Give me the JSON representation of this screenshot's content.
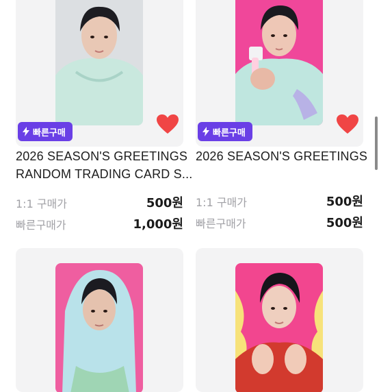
{
  "products": [
    {
      "badge": "빠른구매",
      "title_line1": "2026 SEASON'S GREETINGS",
      "title_line2": "RANDOM TRADING CARD S...",
      "price_1to1_label": "1:1 구매가",
      "price_1to1": "500원",
      "price_quick_label": "빠른구매가",
      "price_quick": "1,000원",
      "favorited": true,
      "photo_colors": {
        "bg": "#d9dde0",
        "hoodie": "#c9e8de",
        "skin": "#e9c8b5",
        "hair": "#1d1d22"
      }
    },
    {
      "badge": "빠른구매",
      "title_line1": "2026 SEASON'S GREETINGS",
      "title_line2": "",
      "price_1to1_label": "1:1 구매가",
      "price_1to1": "500원",
      "price_quick_label": "빠른구매가",
      "price_quick": "500원",
      "favorited": true,
      "photo_colors": {
        "bg": "#f0479a",
        "hoodie": "#bfe6df",
        "skin": "#eec7b6",
        "hair": "#1a1a20"
      }
    },
    {
      "photo_colors": {
        "bg": "#ef5ea0",
        "hoodie": "#b9e2ea",
        "skin": "#e5c2ae",
        "hair": "#1b1b21"
      }
    },
    {
      "photo_colors": {
        "bg": "#f2468f",
        "hoodie": "#d23a2e",
        "skin": "#efcfbf",
        "hair": "#15151a"
      }
    }
  ],
  "colors": {
    "accent": "#6a3fe6",
    "heart": "#f04545"
  },
  "icons": {
    "badge": "lightning-icon",
    "favorite": "heart-icon"
  }
}
